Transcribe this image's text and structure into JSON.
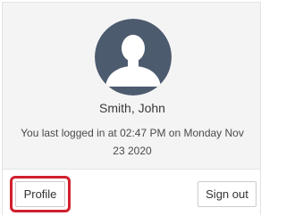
{
  "user": {
    "name": "Smith, John",
    "last_login_line1": "You last logged in at 02:47 PM on Monday Nov",
    "last_login_line2": "23 2020"
  },
  "avatar": {
    "icon": "person-silhouette-icon",
    "background_color": "#4d5b6f",
    "figure_color": "#ffffff"
  },
  "actions": {
    "profile_label": "Profile",
    "signout_label": "Sign out"
  },
  "highlight": {
    "target": "profile-button",
    "color": "#d0202e"
  }
}
